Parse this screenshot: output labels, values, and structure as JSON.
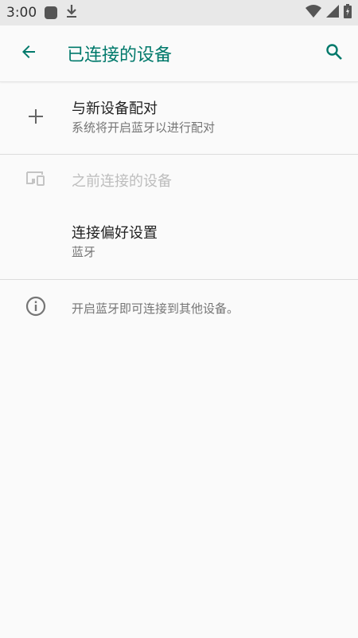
{
  "status_bar": {
    "time": "3:00"
  },
  "app_bar": {
    "title": "已连接的设备"
  },
  "list": {
    "pair_new": {
      "title": "与新设备配对",
      "summary": "系统将开启蓝牙以进行配对"
    },
    "previously_connected": {
      "title": "之前连接的设备"
    },
    "connection_prefs": {
      "title": "连接偏好设置",
      "summary": "蓝牙"
    },
    "footer_info": "开启蓝牙即可连接到其他设备。"
  },
  "colors": {
    "accent": "#00796b",
    "status_bar_bg": "#e8e8e8",
    "background": "#fafafa"
  }
}
